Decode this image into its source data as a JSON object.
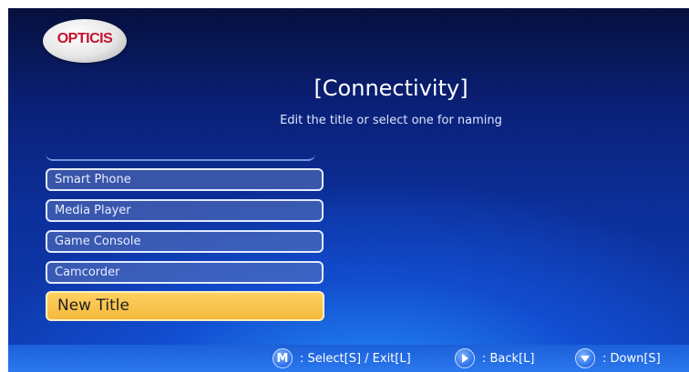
{
  "brand": {
    "logo_text": "OPTICIS"
  },
  "screen": {
    "title": "[Connectivity]",
    "subtitle": "Edit the title or select one for naming"
  },
  "menu": {
    "items": [
      {
        "label": "Smart Phone",
        "selected": false
      },
      {
        "label": "Media Player",
        "selected": false
      },
      {
        "label": "Game Console",
        "selected": false
      },
      {
        "label": "Camcorder",
        "selected": false
      },
      {
        "label": "New Title",
        "selected": true
      }
    ]
  },
  "footer": {
    "hints": [
      {
        "icon": "m-button-icon",
        "glyph": "M",
        "label": ": Select[S] / Exit[L]"
      },
      {
        "icon": "right-arrow-button-icon",
        "label": ": Back[L]"
      },
      {
        "icon": "down-arrow-button-icon",
        "label": ": Down[S]"
      }
    ]
  },
  "colors": {
    "background_top": "#06103d",
    "background_glow": "#2896ff",
    "selected_item": "#f4b93c",
    "footer_bar": "#2b78ee",
    "logo_red": "#c4122f"
  }
}
